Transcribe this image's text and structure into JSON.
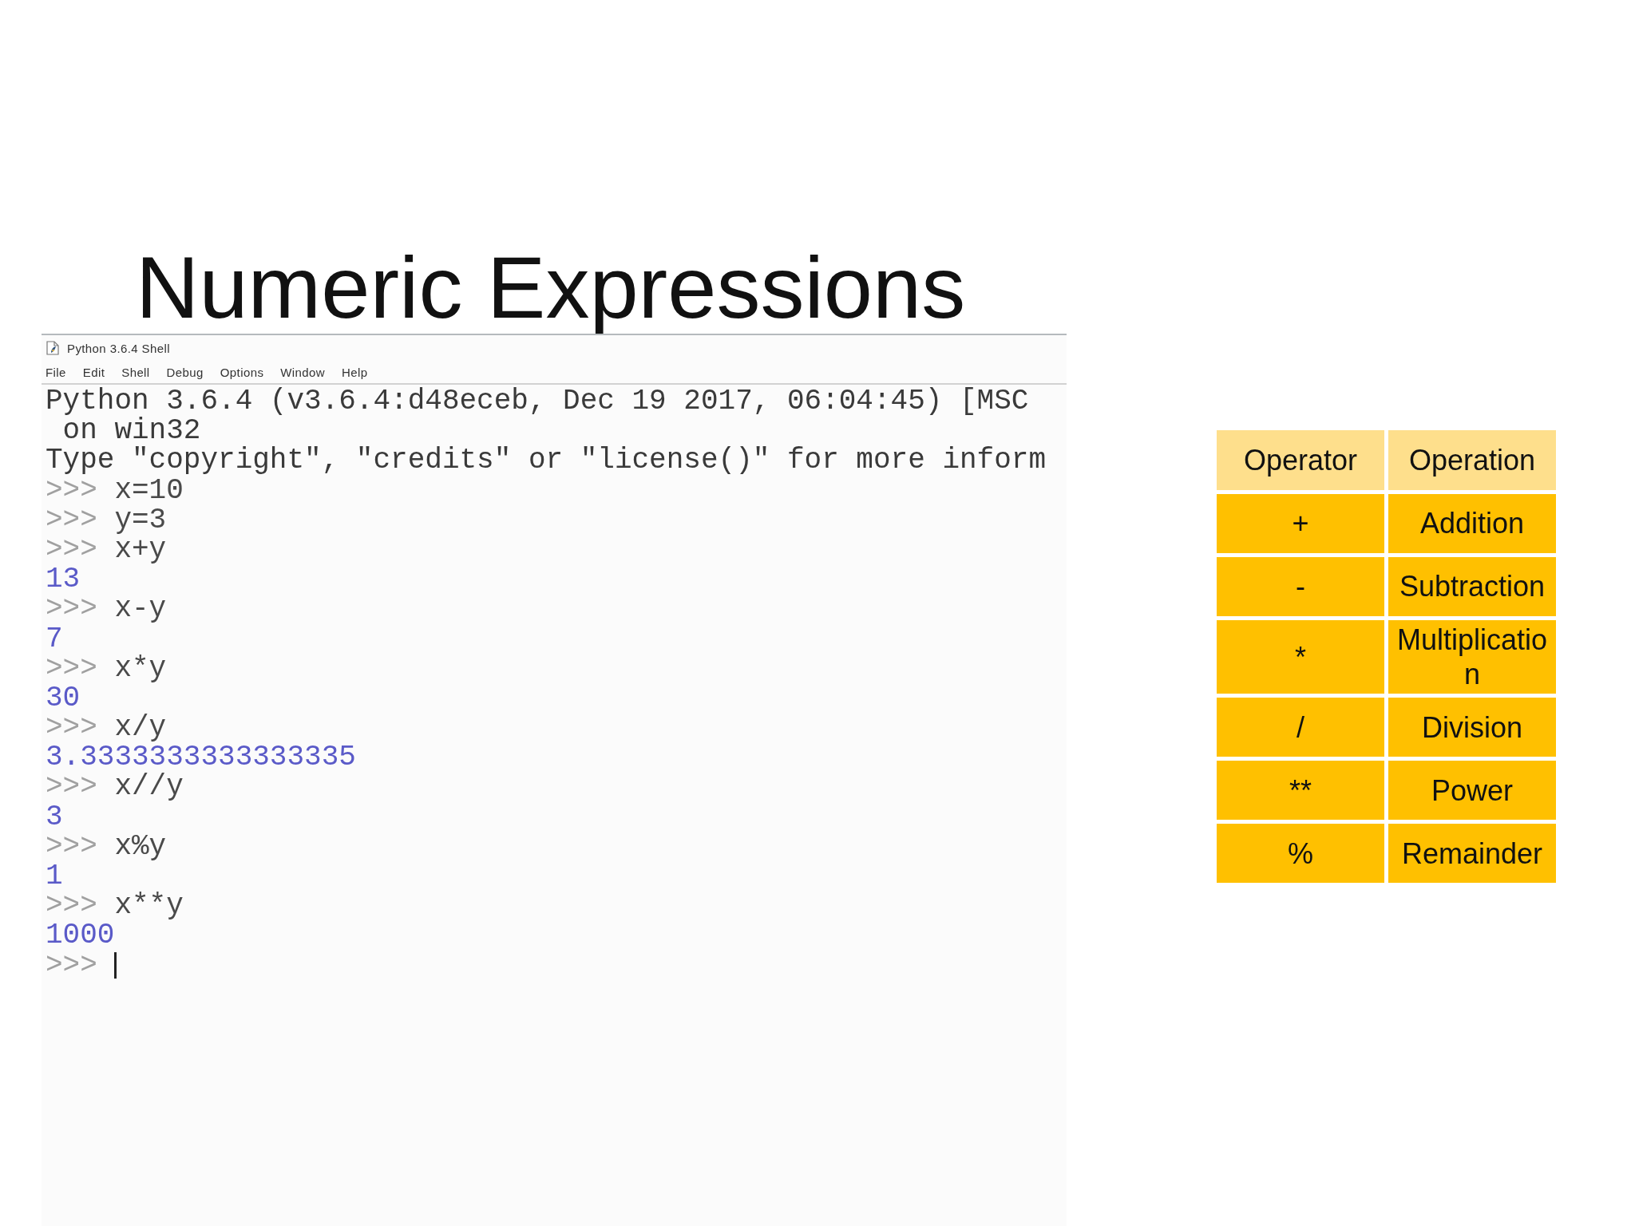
{
  "slide": {
    "title": "Numeric Expressions"
  },
  "shell_window": {
    "title": "Python 3.6.4 Shell",
    "menu": [
      "File",
      "Edit",
      "Shell",
      "Debug",
      "Options",
      "Window",
      "Help"
    ],
    "lines": [
      {
        "kind": "banner",
        "text": "Python 3.6.4 (v3.6.4:d48eceb, Dec 19 2017, 06:04:45) [MSC"
      },
      {
        "kind": "wrapped",
        "text": "on win32"
      },
      {
        "kind": "banner",
        "text": "Type \"copyright\", \"credits\" or \"license()\" for more inform"
      },
      {
        "kind": "input",
        "prompt": ">>>",
        "code": "x=10",
        "cursor": false
      },
      {
        "kind": "input",
        "prompt": ">>>",
        "code": "y=3",
        "cursor": false
      },
      {
        "kind": "input",
        "prompt": ">>>",
        "code": "x+y",
        "cursor": false
      },
      {
        "kind": "output",
        "text": "13"
      },
      {
        "kind": "input",
        "prompt": ">>>",
        "code": "x-y",
        "cursor": false
      },
      {
        "kind": "output",
        "text": "7"
      },
      {
        "kind": "input",
        "prompt": ">>>",
        "code": "x*y",
        "cursor": false
      },
      {
        "kind": "output",
        "text": "30"
      },
      {
        "kind": "input",
        "prompt": ">>>",
        "code": "x/y",
        "cursor": false
      },
      {
        "kind": "output",
        "text": "3.3333333333333335"
      },
      {
        "kind": "input",
        "prompt": ">>>",
        "code": "x//y",
        "cursor": false
      },
      {
        "kind": "output",
        "text": "3"
      },
      {
        "kind": "input",
        "prompt": ">>>",
        "code": "x%y",
        "cursor": false
      },
      {
        "kind": "output",
        "text": "1"
      },
      {
        "kind": "input",
        "prompt": ">>>",
        "code": "x**y",
        "cursor": false
      },
      {
        "kind": "output",
        "text": "1000"
      },
      {
        "kind": "input",
        "prompt": ">>>",
        "cursor": true
      }
    ]
  },
  "table": {
    "columns": [
      "Operator",
      "Operation"
    ],
    "rows": [
      [
        "+",
        "Addition"
      ],
      [
        "-",
        "Subtraction"
      ],
      [
        "*",
        "Multiplication"
      ],
      [
        "/",
        "Division"
      ],
      [
        "**",
        "Power"
      ],
      [
        "%",
        "Remainder"
      ]
    ]
  }
}
